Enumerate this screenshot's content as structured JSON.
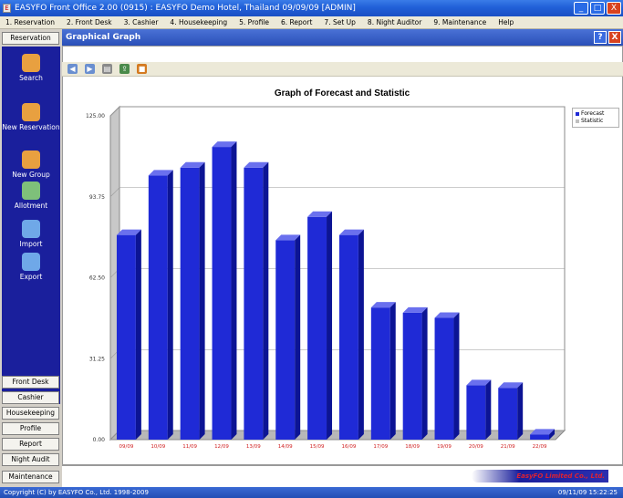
{
  "window": {
    "title": "EASYFO Front Office 2.00 (0915) : EASYFO Demo Hotel, Thailand 09/09/09 [ADMIN]",
    "minimize": "_",
    "maximize": "□",
    "close": "X"
  },
  "menu": [
    "1. Reservation",
    "2. Front Desk",
    "3. Cashier",
    "4. Housekeeping",
    "5. Profile",
    "6. Report",
    "7. Set Up",
    "8. Night Auditor",
    "9. Maintenance",
    "Help"
  ],
  "sidebar": {
    "top_button": "Reservation",
    "items": [
      {
        "label": "Search",
        "icon": "person-search-icon",
        "color": "#e8a040"
      },
      {
        "label": "New Reservation",
        "icon": "person-add-icon",
        "color": "#e8a040"
      },
      {
        "label": "New Group",
        "icon": "group-icon",
        "color": "#e8a040"
      },
      {
        "label": "Allotment",
        "icon": "allotment-icon",
        "color": "#7ec07a"
      },
      {
        "label": "Import",
        "icon": "import-icon",
        "color": "#6fa8e8"
      },
      {
        "label": "Export",
        "icon": "export-icon",
        "color": "#6fa8e8"
      }
    ],
    "bottom_buttons": [
      "Front Desk",
      "Cashier",
      "Housekeeping",
      "Profile",
      "Report",
      "Night Audit",
      "Maintenance"
    ]
  },
  "panel": {
    "title": "Graphical Graph",
    "help": "?",
    "close": "X"
  },
  "toolbar": {
    "icons": [
      "back-icon",
      "forward-icon",
      "print-icon",
      "export-icon",
      "close-icon"
    ]
  },
  "legend": {
    "items": [
      {
        "label": "Forecast",
        "color": "#1f2ad6"
      },
      {
        "label": "Statistic",
        "color": "#c0c0c0"
      }
    ]
  },
  "status": {
    "copyright": "Copyright (C) by EASYFO Co., Ltd. 1998-2009",
    "datetime": "09/11/09   15:22:25"
  },
  "bottom_logo": "EasyFO Limited Co., Ltd.",
  "chart_data": {
    "type": "bar",
    "title": "Graph of Forecast and Statistic",
    "categories": [
      "09/09",
      "10/09",
      "11/09",
      "12/09",
      "13/09",
      "14/09",
      "15/09",
      "16/09",
      "17/09",
      "18/09",
      "19/09",
      "20/09",
      "21/09",
      "22/09"
    ],
    "series": [
      {
        "name": "Forecast",
        "values": [
          79,
          102,
          105,
          113,
          105,
          77,
          86,
          79,
          51,
          49,
          47,
          21,
          20,
          2
        ],
        "color": "#1f2ad6"
      }
    ],
    "y_ticks": [
      "0.00",
      "31.25",
      "62.50",
      "93.75",
      "125.00"
    ],
    "ylim": [
      0,
      125
    ],
    "legend_position": "top-right",
    "grid": true
  }
}
